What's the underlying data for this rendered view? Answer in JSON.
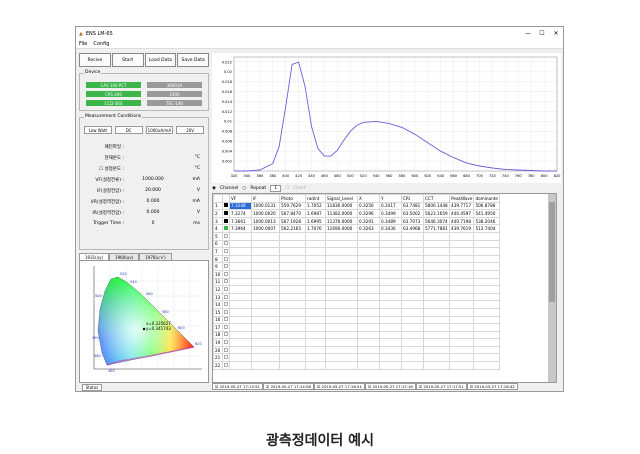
{
  "window": {
    "title": "ENS LM-65",
    "min": "—",
    "max": "☐",
    "close": "✕"
  },
  "menu": [
    "File",
    "Config"
  ],
  "toolbar": [
    "Recive",
    "Start",
    "Load Data",
    "Save Data"
  ],
  "device": {
    "label": "Device",
    "items": [
      {
        "text": "CAS 140 PCT",
        "color": "#3cb54a"
      },
      {
        "text": "36601A",
        "color": "#999999"
      },
      {
        "text": "CPS-200",
        "color": "#3cb54a"
      },
      {
        "text": "2400",
        "color": "#999999"
      },
      {
        "text": "CCD-564",
        "color": "#3cb54a"
      },
      {
        "text": "TEC-140",
        "color": "#999999"
      }
    ]
  },
  "measurement": {
    "label": "Measurement Conditions",
    "modes": [
      "Low Watt",
      "DC",
      "1000uA/mA",
      "20V"
    ],
    "rows": [
      {
        "label": "패턴파일 :",
        "value": "",
        "unit": ""
      },
      {
        "label": "현재온도 :",
        "value": "",
        "unit": "°C"
      },
      {
        "label": "☐ 설정온도 :",
        "value": "",
        "unit": "°C"
      },
      {
        "label": "VF(설정전류) :",
        "value": "1000.000",
        "unit": "mA"
      },
      {
        "label": "IF(설정전압) :",
        "value": "20.000",
        "unit": "V"
      },
      {
        "label": "VR(설정역전압) :",
        "value": "0.000",
        "unit": "mA"
      },
      {
        "label": "IR(설정역전압) :",
        "value": "0.000",
        "unit": "V"
      },
      {
        "label": "Trigger Time :",
        "value": "0",
        "unit": "ms"
      }
    ]
  },
  "cieTabs": [
    "1931(xy)",
    "1960(uv)",
    "1976(u'v')"
  ],
  "cie": {
    "readout_x": "x=0.325627",
    "readout_y": "y=0.341743",
    "edge_labels": [
      "520",
      "540",
      "560",
      "580",
      "600",
      "620",
      "500",
      "490",
      "480",
      "460"
    ]
  },
  "status": "Status",
  "channel": {
    "ch": "Channel",
    "repeat": "Repeat",
    "count": "1",
    "chartlbl": "Chart"
  },
  "chart_data": {
    "type": "line",
    "x": [
      320,
      340,
      360,
      380,
      390,
      400,
      410,
      420,
      430,
      440,
      450,
      460,
      470,
      480,
      490,
      500,
      510,
      520,
      540,
      560,
      580,
      600,
      620,
      640,
      660,
      680,
      700,
      720,
      740,
      760,
      780,
      800,
      820
    ],
    "y": [
      0,
      0,
      0.0002,
      0.0015,
      0.005,
      0.013,
      0.0215,
      0.022,
      0.017,
      0.009,
      0.0045,
      0.003,
      0.003,
      0.0042,
      0.0062,
      0.008,
      0.0092,
      0.0098,
      0.01,
      0.0096,
      0.0088,
      0.0074,
      0.0057,
      0.004,
      0.0027,
      0.0016,
      0.001,
      0.0006,
      0.0003,
      0.0002,
      0.0001,
      0,
      0
    ],
    "xlim": [
      320,
      820
    ],
    "ylim": [
      0,
      0.023
    ],
    "xticks": [
      320,
      340,
      360,
      380,
      400,
      420,
      440,
      460,
      480,
      500,
      520,
      540,
      560,
      580,
      600,
      620,
      640,
      660,
      680,
      700,
      720,
      740,
      760,
      780,
      800,
      820
    ],
    "yticks": [
      0.002,
      0.004,
      0.006,
      0.008,
      0.01,
      0.012,
      0.014,
      0.016,
      0.018,
      0.02,
      0.022
    ],
    "color": "#6b5fd8"
  },
  "table": {
    "headers": [
      "",
      "",
      "VF",
      "IF",
      "Photo",
      "radint",
      "Signal_Level",
      "X",
      "Y",
      "CRI",
      "CCT",
      "PeakWave",
      "dominante"
    ],
    "rows": [
      {
        "n": "1",
        "sw": "#000000",
        "c": [
          "7.3248",
          "1000.0131",
          "559.7629",
          "1.7052",
          "11836.0000",
          "0.3256",
          "0.3417",
          "63.7481",
          "5806.1448",
          "439.7717",
          "506.8788"
        ]
      },
      {
        "n": "2",
        "sw": "#000000",
        "c": [
          "7.3274",
          "1000.0020",
          "567.8470",
          "1.6987",
          "11382.0000",
          "0.3296",
          "0.3499",
          "63.5002",
          "5623.1659",
          "440.4597",
          "541.4950"
        ]
      },
      {
        "n": "3",
        "sw": "#000000",
        "c": [
          "7.3661",
          "1000.0013",
          "567.1928",
          "1.6995",
          "11376.0000",
          "0.3291",
          "0.3489",
          "63.7073",
          "5646.3074",
          "440.7198",
          "538.2046"
        ]
      },
      {
        "n": "4",
        "sw": "#3cb54a",
        "c": [
          "7.3964",
          "1000.0007",
          "562.2165",
          "1.7076",
          "11690.0000",
          "0.3263",
          "0.3436",
          "63.4968",
          "5771.7881",
          "439.7619",
          "512.7404"
        ]
      }
    ],
    "emptyRows": [
      "5",
      "6",
      "7",
      "8",
      "9",
      "10",
      "11",
      "12",
      "13",
      "14",
      "15",
      "16",
      "17",
      "18",
      "19",
      "20",
      "21",
      "22"
    ]
  },
  "bottomTabs": [
    "2019-05-27 17:13:51",
    "2019-05-27 17:14:58",
    "2019-05-27 17:16:51",
    "2019-05-27 17:17:16",
    "2019-05-27 17:17:51",
    "2019-05-27 17:18:42"
  ],
  "caption": "광측정데이터 예시"
}
